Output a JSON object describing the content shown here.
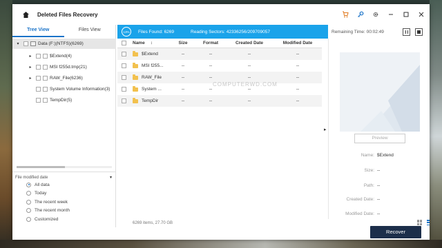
{
  "window": {
    "title": "Deleted Files Recovery"
  },
  "tabs": [
    "Tree View",
    "Files View"
  ],
  "tree": [
    {
      "label": "Data (F:)(NTFS)(6269)",
      "level": 0,
      "expanded": true,
      "selected": true
    },
    {
      "label": "$Extend(4)",
      "level": 1,
      "has_children": true
    },
    {
      "label": "MSI f255d.tmp(21)",
      "level": 1,
      "has_children": true
    },
    {
      "label": "RAW_File(6236)",
      "level": 1,
      "has_children": true
    },
    {
      "label": "System Volume Information(3)",
      "level": 1,
      "has_children": false
    },
    {
      "label": "TempDir(5)",
      "level": 1,
      "has_children": false
    }
  ],
  "filter": {
    "title": "File modified date",
    "options": [
      "All data",
      "Today",
      "The recent week",
      "The recent month",
      "Customized"
    ],
    "selected_index": 0
  },
  "status": {
    "progress": "13%",
    "files_found": "Files Found: 6269",
    "reading_sectors": "Reading Sectors: 42336256/209709057",
    "remaining_time": "Remaining Time: 00:02:49"
  },
  "table": {
    "columns": [
      "Name",
      "Size",
      "Format",
      "Created Date",
      "Modified Date"
    ],
    "rows": [
      {
        "name": "$Extend",
        "size": "--",
        "format": "--",
        "created": "--",
        "modified": "--"
      },
      {
        "name": "MSI f255...",
        "size": "--",
        "format": "--",
        "created": "--",
        "modified": "--"
      },
      {
        "name": "RAW_File",
        "size": "--",
        "format": "--",
        "created": "--",
        "modified": "--"
      },
      {
        "name": "System ...",
        "size": "--",
        "format": "--",
        "created": "--",
        "modified": "--"
      },
      {
        "name": "TempDir",
        "size": "--",
        "format": "--",
        "created": "--",
        "modified": "--"
      }
    ]
  },
  "watermark": "COMPUTERWD.COM",
  "footer": {
    "count": "6269 items, 27.70 GB"
  },
  "preview": {
    "button": "Preview",
    "props": [
      {
        "key": "Name:",
        "value": "$Extend"
      },
      {
        "key": "Size:",
        "value": "--"
      },
      {
        "key": "Path:",
        "value": "--"
      },
      {
        "key": "Created Date:",
        "value": "--"
      },
      {
        "key": "Modified Date:",
        "value": "--"
      }
    ]
  },
  "recover_label": "Recover",
  "colors": {
    "accent": "#1aa3ea",
    "tab_active": "#1a73c8",
    "recover_button": "#1c2e4a",
    "folder": "#f2c14e"
  }
}
